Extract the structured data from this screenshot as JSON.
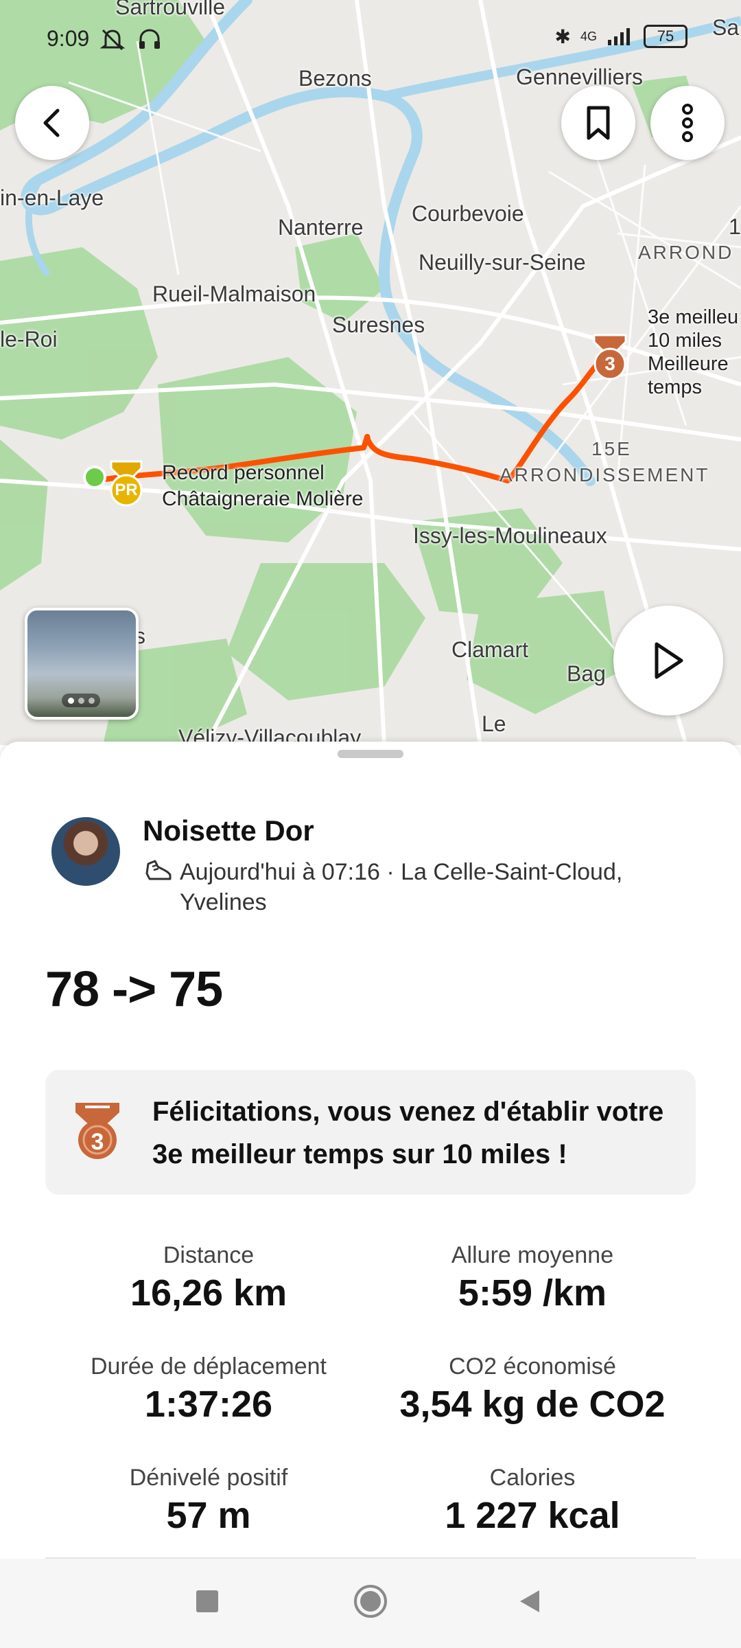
{
  "status_bar": {
    "time": "9:09",
    "network": "4G",
    "battery": "75"
  },
  "map": {
    "labels": {
      "sartrouville": "Sartrouville",
      "bezons": "Bezons",
      "gennevilliers": "Gennevilliers",
      "sa": "Sa",
      "laye": "in-en-Laye",
      "nanterre": "Nanterre",
      "courbevoie": "Courbevoie",
      "neuilly": "Neuilly-sur-Seine",
      "arrond_top": "ARROND",
      "rueil": "Rueil-Malmaison",
      "suresnes": "Suresnes",
      "le_roi": "le-Roi",
      "issy": "Issy-les-Moulineaux",
      "clamart": "Clamart",
      "bag": "Bag",
      "le": "Le",
      "velizy": "Vélizy-Villacoublay",
      "s": "s",
      "arr15": "15E",
      "arrondissement": "ARRONDISSEMENT",
      "one": "1"
    },
    "pr_label": {
      "line1": "Record personnel",
      "line2": "Châtaigneraie Molière"
    },
    "pr_badge": "PR",
    "best_label": {
      "line1": "3e meilleu",
      "line2": "10 miles",
      "line3": "Meilleure",
      "line4": "temps"
    },
    "medal_rank": "3",
    "route_color": "#FC5200"
  },
  "activity": {
    "athlete": "Noisette Dor",
    "meta": "Aujourd'hui à 07:16 · La Celle-Saint-Cloud, Yvelines",
    "title": "78 -> 75",
    "achievement": "Félicitations, vous venez d'établir votre 3e meilleur temps sur 10 miles !",
    "achievement_rank": "3",
    "stats": {
      "distance": {
        "label": "Distance",
        "value": "16,26 km"
      },
      "pace": {
        "label": "Allure moyenne",
        "value": "5:59 /km"
      },
      "moving_time": {
        "label": "Durée de déplacement",
        "value": "1:37:26"
      },
      "co2": {
        "label": "CO2 économisé",
        "value": "3,54 kg de CO2"
      },
      "elevation": {
        "label": "Dénivelé positif",
        "value": "57 m"
      },
      "calories": {
        "label": "Calories",
        "value": "1 227 kcal"
      }
    }
  },
  "icons": {
    "back": "back-arrow-icon",
    "bookmark": "bookmark-icon",
    "more": "more-vertical-icon",
    "play": "play-icon",
    "shoe": "run-shoe-icon",
    "medal": "medal-icon",
    "nav_recents": "square-icon",
    "nav_home": "circle-icon",
    "nav_back": "triangle-back-icon"
  }
}
